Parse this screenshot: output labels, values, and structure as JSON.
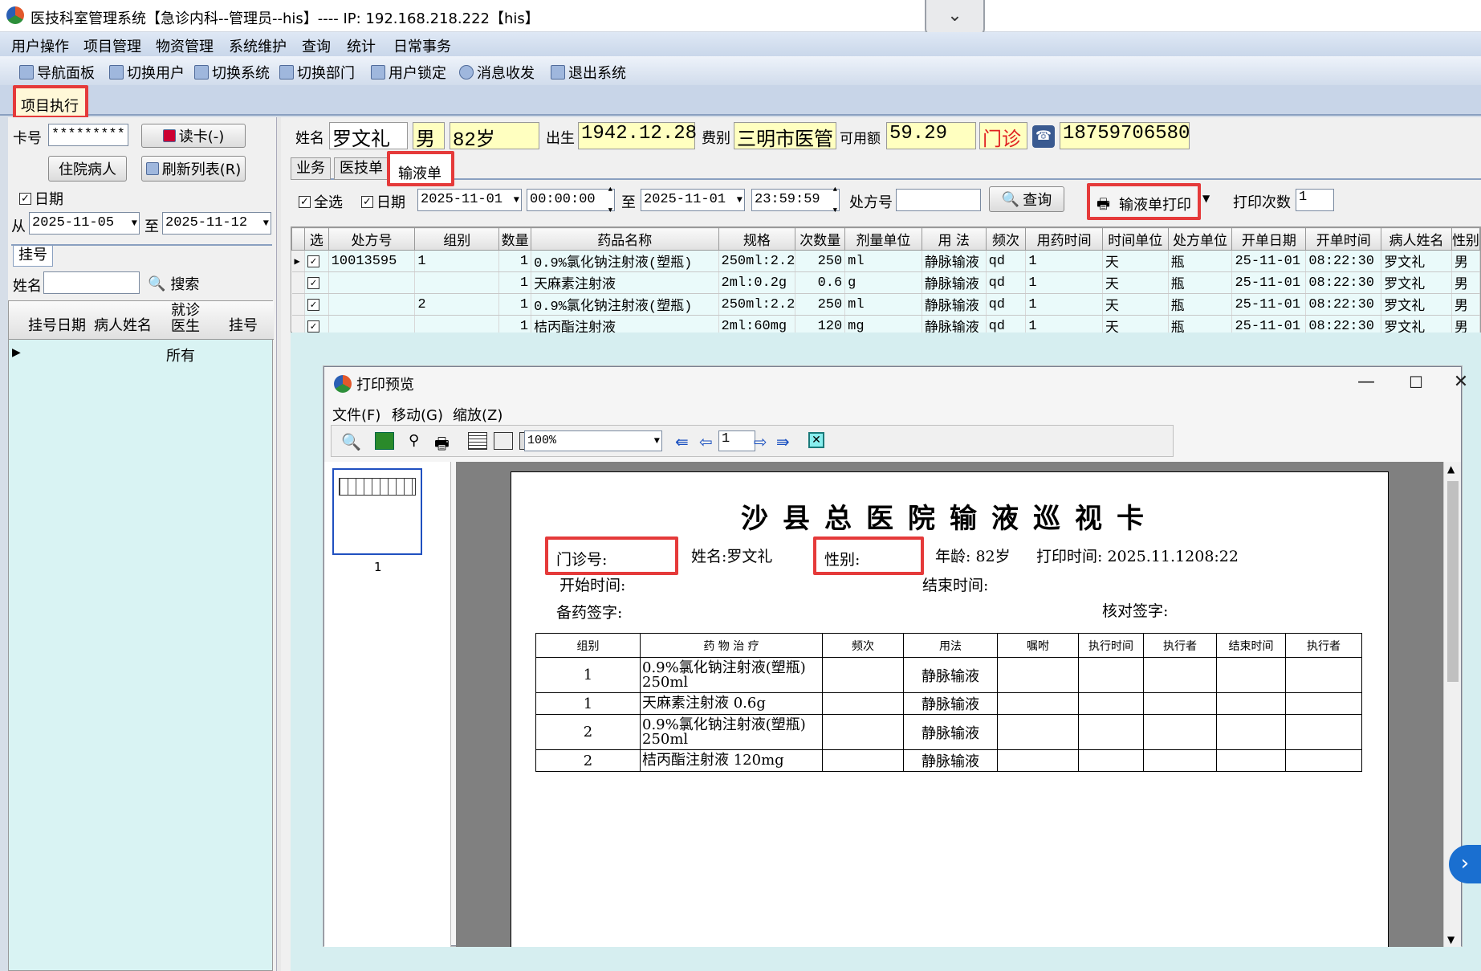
{
  "window": {
    "title": "医技科室管理系统【急诊内科--管理员--his】---- IP: 192.168.218.222【his】"
  },
  "menu": [
    "用户操作",
    "项目管理",
    "物资管理",
    "系统维护",
    "查询",
    "统计",
    "日常事务"
  ],
  "toolbar": [
    "导航面板",
    "切换用户",
    "切换系统",
    "切换部门",
    "用户锁定",
    "消息收发",
    "退出系统"
  ],
  "main_tab": "项目执行",
  "left": {
    "card_label": "卡号",
    "card_value": "*********",
    "read_card": "读卡(-)",
    "inpatient": "住院病人",
    "refresh": "刷新列表(R)",
    "date_chk": "日期",
    "from_label": "从",
    "date_from": "2025-11-05",
    "to_label": "至",
    "date_to": "2025-11-12",
    "sub_tab": "挂号",
    "name_label": "姓名",
    "search": "搜索",
    "grid_headers": [
      "挂号日期",
      "病人姓名",
      "就诊医生",
      "挂号"
    ],
    "grid_row_all": "所有"
  },
  "patient": {
    "name_label": "姓名",
    "name": "罗文礼",
    "gender": "男",
    "age": "82岁",
    "birth_label": "出生",
    "birth": "1942.12.28",
    "fee_label": "费别",
    "fee": "三明市医管",
    "balance_label": "可用额",
    "balance": "59.29",
    "visit_type": "门诊",
    "phone": "18759706580"
  },
  "sub_tabs": [
    "业务",
    "医技单",
    "输液单"
  ],
  "filter": {
    "select_all": "全选",
    "date_chk": "日期",
    "date_from": "2025-11-01",
    "time_from": "00:00:00",
    "to": "至",
    "date_to": "2025-11-01",
    "time_to": "23:59:59",
    "rx_label": "处方号",
    "query": "查询",
    "print_btn": "输液单打印",
    "print_count_label": "打印次数",
    "print_count": "1"
  },
  "grid": {
    "headers": [
      "选",
      "处方号",
      "组别",
      "数量",
      "药品名称",
      "规格",
      "次数量",
      "剂量单位",
      "用 法",
      "频次",
      "用药时间",
      "时间单位",
      "处方单位",
      "开单日期",
      "开单时间",
      "病人姓名",
      "性别"
    ],
    "rows": [
      [
        "",
        "10013595",
        "1",
        "1",
        "0.9%氯化钠注射液(塑瓶)",
        "250ml:2.2",
        "250",
        "ml",
        "静脉输液",
        "qd",
        "1",
        "天",
        "瓶",
        "25-11-01",
        "08:22:30",
        "罗文礼",
        "男"
      ],
      [
        "",
        "",
        "",
        "1",
        "天麻素注射液",
        "2ml:0.2g",
        "0.6",
        "g",
        "静脉输液",
        "qd",
        "1",
        "天",
        "瓶",
        "25-11-01",
        "08:22:30",
        "罗文礼",
        "男"
      ],
      [
        "",
        "",
        "2",
        "1",
        "0.9%氯化钠注射液(塑瓶)",
        "250ml:2.2",
        "250",
        "ml",
        "静脉输液",
        "qd",
        "1",
        "天",
        "瓶",
        "25-11-01",
        "08:22:30",
        "罗文礼",
        "男"
      ],
      [
        "",
        "",
        "",
        "1",
        "桔丙酯注射液",
        "2ml:60mg",
        "120",
        "mg",
        "静脉输液",
        "qd",
        "1",
        "天",
        "瓶",
        "25-11-01",
        "08:22:30",
        "罗文礼",
        "男"
      ]
    ]
  },
  "preview": {
    "title": "打印预览",
    "menu": [
      "文件(F)",
      "移动(G)",
      "缩放(Z)"
    ],
    "zoom": "100%",
    "page_input": "1",
    "thumb_page": "1",
    "doc": {
      "title": "沙县总医院输液巡视卡",
      "clinic_no": "门诊号:",
      "name": "姓名:罗文礼",
      "gender": "性别:",
      "age": "年龄: 82岁",
      "print_time": "打印时间: 2025.11.1208:22",
      "start": "开始时间:",
      "end": "结束时间:",
      "prep_sign": "备药签字:",
      "check_sign": "核对签字:",
      "headers": [
        "组别",
        "药 物 治 疗",
        "频次",
        "用法",
        "嘱咐",
        "执行时间",
        "执行者",
        "结束时间",
        "执行者"
      ],
      "rows": [
        [
          "1",
          "0.9%氯化钠注射液(塑瓶) 250ml",
          "",
          "静脉输液"
        ],
        [
          "1",
          "天麻素注射液 0.6g",
          "",
          "静脉输液"
        ],
        [
          "2",
          "0.9%氯化钠注射液(塑瓶) 250ml",
          "",
          "静脉输液"
        ],
        [
          "2",
          "桔丙酯注射液 120mg",
          "",
          "静脉输液"
        ]
      ]
    }
  },
  "colors": {
    "highlight_red": "#e53a3a",
    "visit_red": "#e02020",
    "grid_row_bg": "#eafafa",
    "yellow_field": "#ffffc0"
  }
}
